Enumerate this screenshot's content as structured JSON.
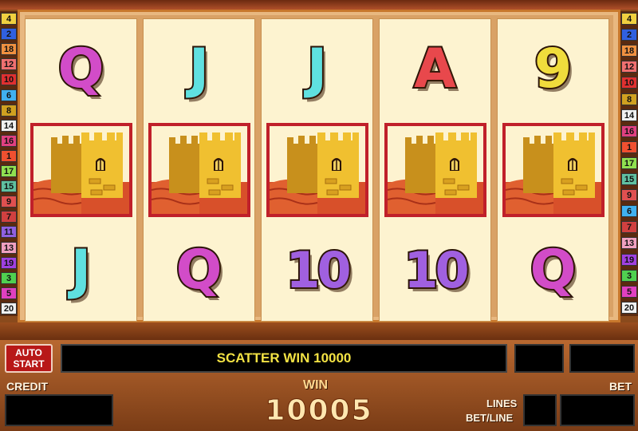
{
  "reels": [
    [
      {
        "symbol": "Q",
        "kind": "Q"
      },
      {
        "symbol": "tower",
        "kind": "tower"
      },
      {
        "symbol": "J",
        "kind": "J"
      }
    ],
    [
      {
        "symbol": "J",
        "kind": "J"
      },
      {
        "symbol": "tower",
        "kind": "tower"
      },
      {
        "symbol": "Q",
        "kind": "Q"
      }
    ],
    [
      {
        "symbol": "J",
        "kind": "J"
      },
      {
        "symbol": "tower",
        "kind": "tower"
      },
      {
        "symbol": "10",
        "kind": "n10"
      }
    ],
    [
      {
        "symbol": "A",
        "kind": "A"
      },
      {
        "symbol": "tower",
        "kind": "tower"
      },
      {
        "symbol": "10",
        "kind": "n10"
      }
    ],
    [
      {
        "symbol": "9",
        "kind": "n9"
      },
      {
        "symbol": "tower",
        "kind": "tower"
      },
      {
        "symbol": "Q",
        "kind": "Q"
      }
    ]
  ],
  "left_paylines": [
    {
      "n": "4",
      "color": "#f0d040"
    },
    {
      "n": "2",
      "color": "#3060e0"
    },
    {
      "n": "18",
      "color": "#f09040"
    },
    {
      "n": "12",
      "color": "#f07070"
    },
    {
      "n": "10",
      "color": "#e03030"
    },
    {
      "n": "6",
      "color": "#40b0f0"
    },
    {
      "n": "8",
      "color": "#d0a020"
    },
    {
      "n": "14",
      "color": "#f0f0f0"
    },
    {
      "n": "16",
      "color": "#e04080"
    },
    {
      "n": "1",
      "color": "#f05030"
    },
    {
      "n": "17",
      "color": "#90e050"
    },
    {
      "n": "15",
      "color": "#60c0a0"
    },
    {
      "n": "9",
      "color": "#e05050"
    },
    {
      "n": "7",
      "color": "#d04040"
    },
    {
      "n": "11",
      "color": "#9060e0"
    },
    {
      "n": "13",
      "color": "#f0a0c0"
    },
    {
      "n": "19",
      "color": "#a040e0"
    },
    {
      "n": "3",
      "color": "#50d050"
    },
    {
      "n": "5",
      "color": "#e040c0"
    },
    {
      "n": "20",
      "color": "#f0f0f0"
    }
  ],
  "right_paylines": [
    {
      "n": "4",
      "color": "#f0d040"
    },
    {
      "n": "2",
      "color": "#3060e0"
    },
    {
      "n": "18",
      "color": "#f09040"
    },
    {
      "n": "12",
      "color": "#f07070"
    },
    {
      "n": "10",
      "color": "#e03030"
    },
    {
      "n": "8",
      "color": "#d0a020"
    },
    {
      "n": "14",
      "color": "#f0f0f0"
    },
    {
      "n": "16",
      "color": "#e04080"
    },
    {
      "n": "1",
      "color": "#f05030"
    },
    {
      "n": "17",
      "color": "#90e050"
    },
    {
      "n": "15",
      "color": "#60c0a0"
    },
    {
      "n": "9",
      "color": "#e05050"
    },
    {
      "n": "6",
      "color": "#40b0f0"
    },
    {
      "n": "7",
      "color": "#d04040"
    },
    {
      "n": "13",
      "color": "#f0a0c0"
    },
    {
      "n": "19",
      "color": "#a040e0"
    },
    {
      "n": "3",
      "color": "#50d050"
    },
    {
      "n": "5",
      "color": "#e040c0"
    },
    {
      "n": "20",
      "color": "#f0f0f0"
    }
  ],
  "controls": {
    "auto_start_line1": "AUTO",
    "auto_start_line2": "START",
    "message": "SCATTER WIN 10000",
    "credit_label": "CREDIT",
    "credit_value": "",
    "win_label": "WIN",
    "win_value": "10005",
    "lines_label": "LINES",
    "betline_label": "BET/LINE",
    "bet_label": "BET",
    "bet_value": ""
  }
}
